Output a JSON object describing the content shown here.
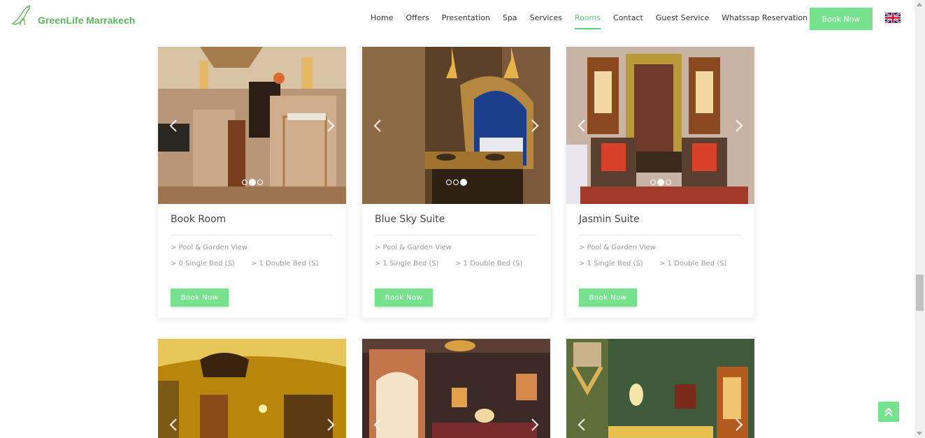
{
  "brand": {
    "name": "GreenLife Marrakech",
    "logo_icon": "bird-logo-icon"
  },
  "nav": [
    {
      "label": "Home",
      "active": false
    },
    {
      "label": "Offers",
      "active": false
    },
    {
      "label": "Presentation",
      "active": false
    },
    {
      "label": "Spa",
      "active": false
    },
    {
      "label": "Services",
      "active": false
    },
    {
      "label": "Rooms",
      "active": true
    },
    {
      "label": "Contact",
      "active": false
    },
    {
      "label": "Guest Service",
      "active": false
    },
    {
      "label": "Whatssap Reservation",
      "active": false
    }
  ],
  "header": {
    "book_now_label": "Book Now",
    "language_icon": "uk-flag-icon"
  },
  "colors": {
    "accent": "#77e28e",
    "brand_text": "#5cb85c",
    "active_nav": "#5cd07a"
  },
  "rooms": [
    {
      "name": "Book Room",
      "view": "> Pool & Garden View",
      "single": "> 0 Single Bed (S)",
      "double": "> 1 Double Bed (S)",
      "button": "Book Now",
      "slide_count": 3,
      "active_slide": 2
    },
    {
      "name": "Blue Sky Suite",
      "view": "> Pool & Garden View",
      "single": "> 1 Single Bed (S)",
      "double": "> 1 Double Bed (S)",
      "button": "Book Now",
      "slide_count": 3,
      "active_slide": 3
    },
    {
      "name": "Jasmin Suite",
      "view": "> Pool & Garden View",
      "single": "> 1 Single Bed (S)",
      "double": "> 1 Double Bed (S)",
      "button": "Book Now",
      "slide_count": 3,
      "active_slide": 2
    }
  ],
  "scroll_to_top_icon": "double-chevron-up-icon"
}
